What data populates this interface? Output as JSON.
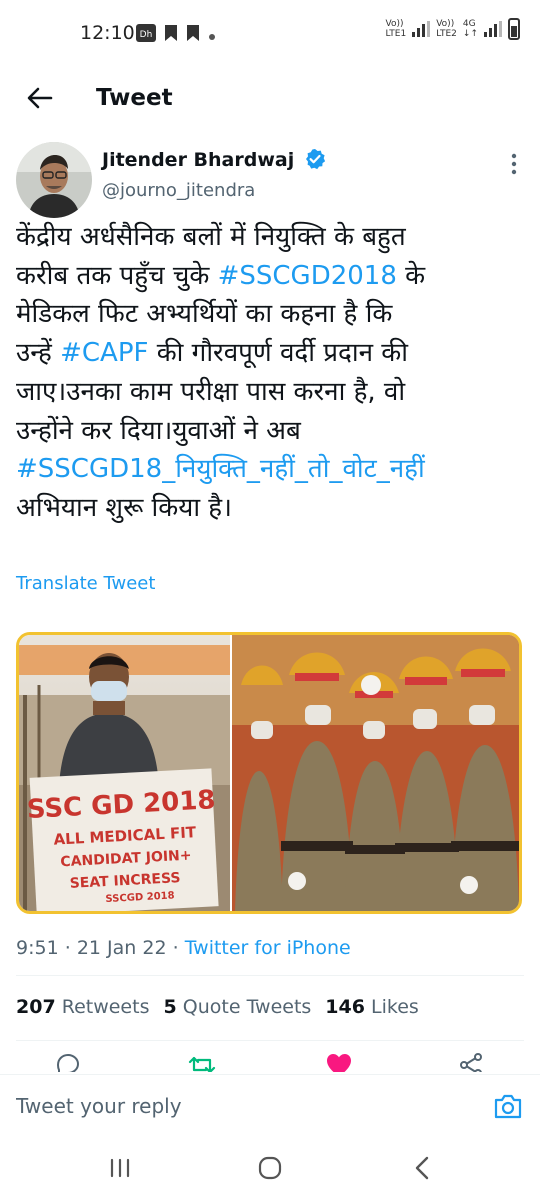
{
  "status_bar": {
    "time": "12:10",
    "network1": [
      "Vo))",
      "LTE1"
    ],
    "network2": [
      "Vo))",
      "LTE2"
    ],
    "network_type": "4G"
  },
  "header": {
    "title": "Tweet",
    "back_icon": "arrow-left-icon"
  },
  "tweet": {
    "author_name": "Jitender Bhardwaj",
    "author_handle": "@journo_jitendra",
    "verified": true,
    "text_lines": [
      [
        {
          "t": "केंद्रीय अर्धसैनिक बलों में नियुक्ति के बहुत"
        }
      ],
      [
        {
          "t": "करीब तक पहुँच चुके "
        },
        {
          "t": "#SSCGD2018",
          "tag": true
        },
        {
          "t": " के"
        }
      ],
      [
        {
          "t": "मेडिकल फिट अभ्यर्थियों का कहना है कि"
        }
      ],
      [
        {
          "t": "उन्हें "
        },
        {
          "t": "#CAPF",
          "tag": true
        },
        {
          "t": " की गौरवपूर्ण वर्दी प्रदान की"
        }
      ],
      [
        {
          "t": "जाए।उनका काम परीक्षा पास करना है, वो"
        }
      ],
      [
        {
          "t": "उन्होंने कर दिया।युवाओं ने अब"
        }
      ],
      [
        {
          "t": "#SSCGD18_नियुक्ति_नहीं_तो_वोट_नहीं",
          "tag": true
        }
      ],
      [
        {
          "t": "अभियान शुरू किया है।"
        }
      ]
    ],
    "translate_label": "Translate Tweet",
    "media": {
      "sign_lines": [
        "SSC GD 2018",
        "ALL MEDICAL FIT",
        "CANDIDAT JOIN+",
        "SEAT INCRESS",
        "SSCGD 2018"
      ]
    },
    "time": "9:51",
    "separator": "·",
    "date": "21 Jan 22",
    "source": "Twitter for iPhone",
    "stats": {
      "retweets_count": "207",
      "retweets_label": "Retweets",
      "quotes_count": "5",
      "quotes_label": "Quote Tweets",
      "likes_count": "146",
      "likes_label": "Likes"
    }
  },
  "reply": {
    "placeholder": "Tweet your reply"
  },
  "colors": {
    "accent": "#1d9bf0",
    "like": "#f91880",
    "retweet": "#00ba7c",
    "media_border": "#f2c230"
  }
}
